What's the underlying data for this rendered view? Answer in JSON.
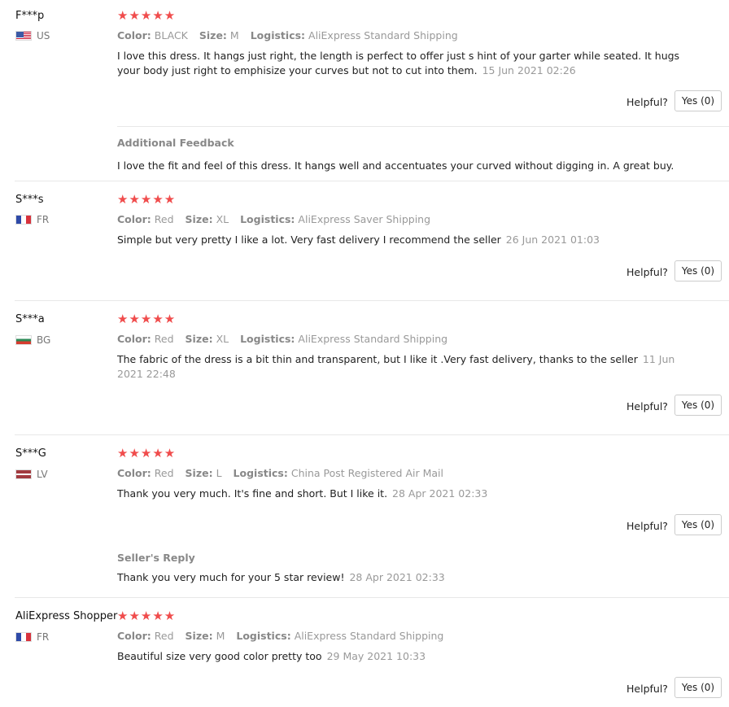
{
  "helpful_label": "Helpful?",
  "reviews": [
    {
      "user": "F***p",
      "country": "US",
      "stars": "★★★★★",
      "attributes": [
        {
          "label": "Color:",
          "value": "BLACK"
        },
        {
          "label": "Size:",
          "value": "M"
        },
        {
          "label": "Logistics:",
          "value": "AliExpress Standard Shipping"
        }
      ],
      "text": "I love this dress. It hangs just right, the length is perfect to offer just s hint of your garter while seated. It hugs your body just right to emphisize your curves but not to cut into them.",
      "date": "15 Jun 2021 02:26",
      "helpful_button": "Yes (0)",
      "additional": {
        "heading": "Additional Feedback",
        "text": "I love the fit and feel of this dress. It hangs well and accentuates your curved without digging in. A great buy."
      }
    },
    {
      "user": "S***s",
      "country": "FR",
      "stars": "★★★★★",
      "attributes": [
        {
          "label": "Color:",
          "value": "Red"
        },
        {
          "label": "Size:",
          "value": "XL"
        },
        {
          "label": "Logistics:",
          "value": "AliExpress Saver Shipping"
        }
      ],
      "text": "Simple but very pretty I like a lot. Very fast delivery I recommend the seller",
      "date": "26 Jun 2021 01:03",
      "helpful_button": "Yes (0)"
    },
    {
      "user": "S***a",
      "country": "BG",
      "stars": "★★★★★",
      "attributes": [
        {
          "label": "Color:",
          "value": "Red"
        },
        {
          "label": "Size:",
          "value": "XL"
        },
        {
          "label": "Logistics:",
          "value": "AliExpress Standard Shipping"
        }
      ],
      "text": "The fabric of the dress is a bit thin and transparent, but I like it .Very fast delivery, thanks to the seller",
      "date": "11 Jun 2021 22:48",
      "helpful_button": "Yes (0)"
    },
    {
      "user": "S***G",
      "country": "LV",
      "stars": "★★★★★",
      "attributes": [
        {
          "label": "Color:",
          "value": "Red"
        },
        {
          "label": "Size:",
          "value": "L"
        },
        {
          "label": "Logistics:",
          "value": "China Post Registered Air Mail"
        }
      ],
      "text": "Thank you very much. It's fine and short. But I like it.",
      "date": "28 Apr 2021 02:33",
      "helpful_button": "Yes (0)",
      "seller_reply": {
        "heading": "Seller's Reply",
        "text": "Thank you very much for your 5 star review!",
        "date": "28 Apr 2021 02:33"
      }
    },
    {
      "user": "AliExpress Shopper",
      "country": "FR",
      "stars": "★★★★★",
      "attributes": [
        {
          "label": "Color:",
          "value": "Red"
        },
        {
          "label": "Size:",
          "value": "M"
        },
        {
          "label": "Logistics:",
          "value": "AliExpress Standard Shipping"
        }
      ],
      "text": "Beautiful size very good color pretty too",
      "date": "29 May 2021 10:33",
      "helpful_button": "Yes (0)"
    }
  ]
}
